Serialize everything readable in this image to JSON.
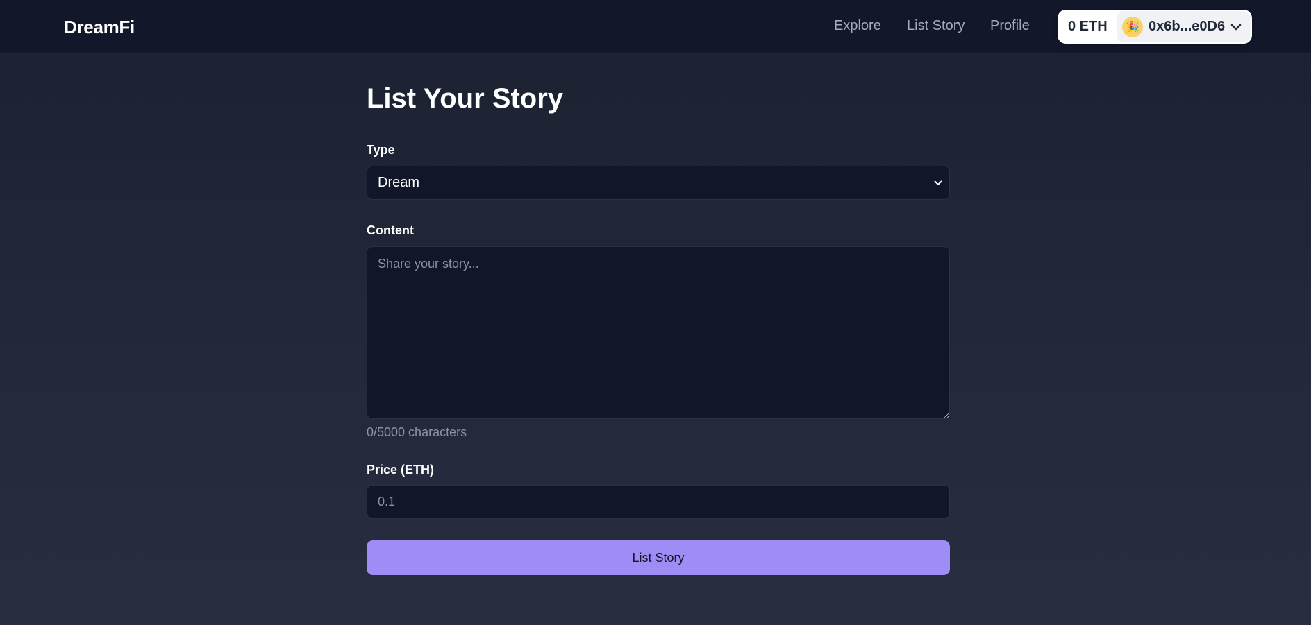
{
  "brand": {
    "name": "DreamFi"
  },
  "nav": {
    "links": [
      {
        "label": "Explore"
      },
      {
        "label": "List Story"
      },
      {
        "label": "Profile"
      }
    ]
  },
  "wallet": {
    "balance": "0 ETH",
    "avatar_icon": "party-popper-icon",
    "avatar_glyph": "🎉",
    "address": "0x6b...e0D6",
    "chevron_icon": "chevron-down-icon"
  },
  "form": {
    "title": "List Your Story",
    "type": {
      "label": "Type",
      "selected": "Dream",
      "chevron_icon": "chevron-down-icon"
    },
    "content": {
      "label": "Content",
      "value": "",
      "placeholder": "Share your story...",
      "char_count": "0/5000 characters"
    },
    "price": {
      "label": "Price (ETH)",
      "value": "",
      "placeholder": "0.1"
    },
    "submit_label": "List Story"
  },
  "colors": {
    "accent": "#a08cf5",
    "navbar_bg": "#121829",
    "input_bg": "#111729",
    "muted_text": "#8b93a5"
  }
}
